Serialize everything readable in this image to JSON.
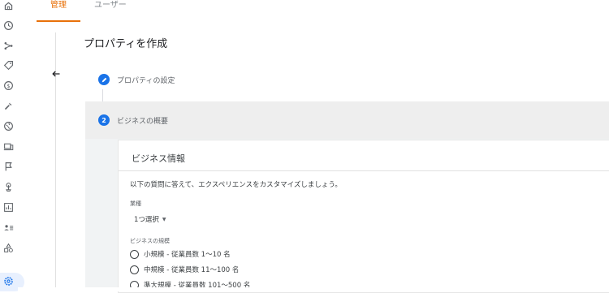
{
  "nav": {
    "tabs": [
      {
        "label": "管理",
        "active": true
      },
      {
        "label": "ユーザー",
        "active": false
      }
    ],
    "rail_icons": [
      "home-icon",
      "clock-icon",
      "branch-icon",
      "tag-icon",
      "dollar-icon",
      "tool-icon",
      "globe-icon",
      "device-icon",
      "flag-icon",
      "touch-icon",
      "chart-icon",
      "people-icon",
      "shapes-icon",
      "settings-icon"
    ]
  },
  "page": {
    "title": "プロパティを作成"
  },
  "steps": [
    {
      "number": "",
      "label": "プロパティの設定",
      "state": "done"
    },
    {
      "number": "2",
      "label": "ビジネスの概要",
      "state": "current"
    }
  ],
  "card": {
    "title": "ビジネス情報",
    "intro": "以下の質問に答えて、エクスペリエンスをカスタマイズしましょう。",
    "industry_label": "業種",
    "industry_value": "1つ選択",
    "size_label": "ビジネスの規模",
    "size_options": [
      "小規模 - 従業員数 1～10 名",
      "中規模 - 従業員数 11～100 名",
      "準大規模 - 従業員数 101～500 名"
    ]
  },
  "colors": {
    "accent": "#e8710a",
    "primary": "#1a73e8"
  }
}
